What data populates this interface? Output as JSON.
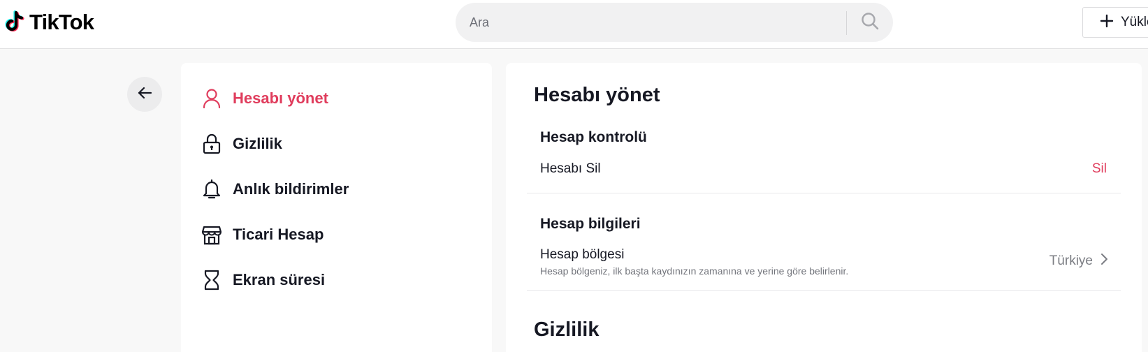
{
  "header": {
    "brand": "TikTok",
    "search": {
      "placeholder": "Ara",
      "value": ""
    },
    "upload_label": "Yükle"
  },
  "sidebar": {
    "items": [
      {
        "label": "Hesabı yönet",
        "icon": "person-icon",
        "active": true
      },
      {
        "label": "Gizlilik",
        "icon": "lock-icon",
        "active": false
      },
      {
        "label": "Anlık bildirimler",
        "icon": "bell-icon",
        "active": false
      },
      {
        "label": "Ticari Hesap",
        "icon": "store-icon",
        "active": false
      },
      {
        "label": "Ekran süresi",
        "icon": "hourglass-icon",
        "active": false
      }
    ]
  },
  "main": {
    "title": "Hesabı yönet",
    "account_control": {
      "heading": "Hesap kontrolü",
      "delete_label": "Hesabı Sil",
      "delete_action": "Sil"
    },
    "account_info": {
      "heading": "Hesap bilgileri",
      "region_label": "Hesap bölgesi",
      "region_desc": "Hesap bölgeniz, ilk başta kaydınızın zamanına ve yerine göre belirlenir.",
      "region_value": "Türkiye"
    },
    "privacy_title": "Gizlilik"
  },
  "colors": {
    "accent": "#e03d5d",
    "text": "#161823",
    "muted": "#7b7d83",
    "background": "#f8f8f8"
  }
}
